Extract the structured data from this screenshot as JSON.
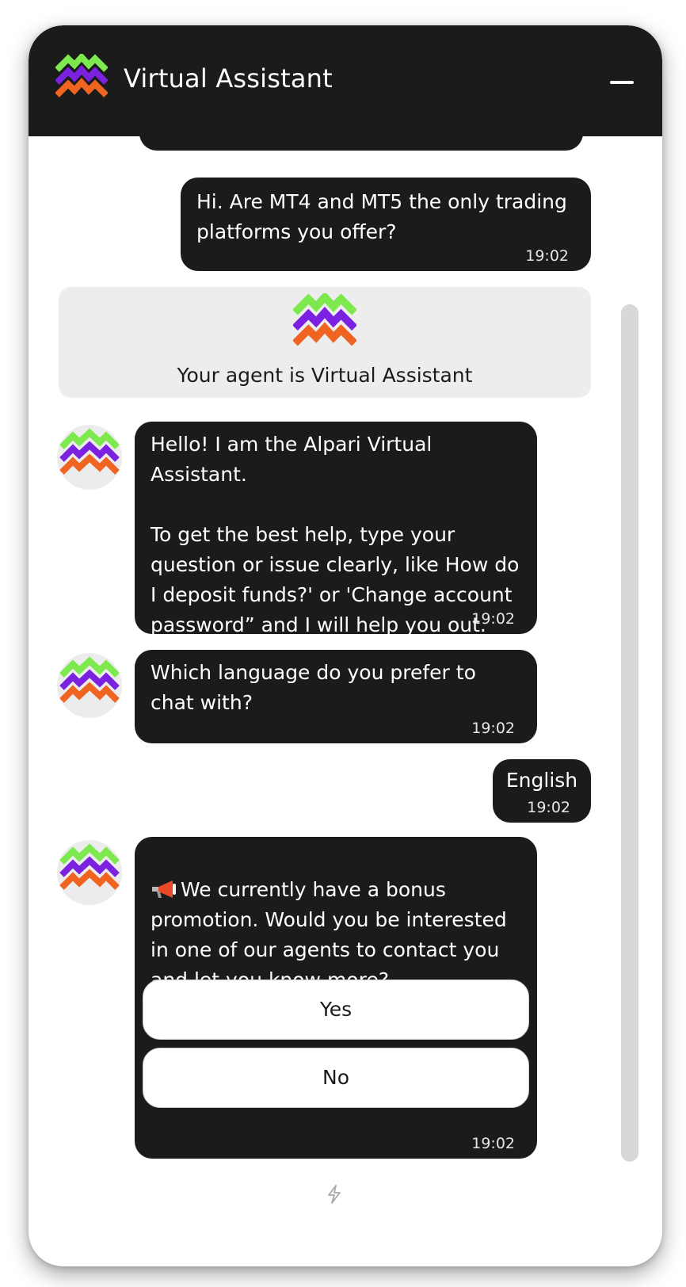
{
  "header": {
    "title": "Virtual Assistant",
    "minimize_icon": "minimize-icon"
  },
  "brand": {
    "logo_colors": [
      "#7ee84f",
      "#7a22e0",
      "#f06422"
    ],
    "header_bg": "#1b1b1b",
    "bubble_bg": "#1b1b1b"
  },
  "messages": {
    "user_1": {
      "text": "Hi. Are MT4 and MT5 the only trading platforms you offer?",
      "time": "19:02"
    },
    "agent_card": {
      "text": "Your agent is Virtual Assistant"
    },
    "bot_1": {
      "text": "Hello! I am the Alpari Virtual Assistant.\n\nTo get the best help, type your question or issue clearly, like How do I deposit funds?' or 'Change account password” and I will help you out.",
      "time": "19:02"
    },
    "bot_2": {
      "text": "Which language do you prefer to chat with?",
      "time": "19:02"
    },
    "user_2": {
      "text": "English",
      "time": "19:02"
    },
    "bot_3": {
      "icon": "megaphone-icon",
      "text": "We currently have a bonus promotion. Would you be interested in one of our agents to contact you and let you know more?",
      "options": [
        "Yes",
        "No"
      ],
      "time": "19:02"
    }
  },
  "footer": {
    "icon": "lightning-icon"
  }
}
